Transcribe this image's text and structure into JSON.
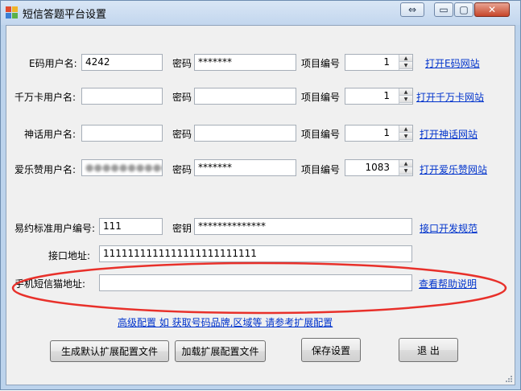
{
  "window": {
    "title": "短信答题平台设置",
    "buttons": {
      "restore": "⇔",
      "minimize": "▭",
      "maximize": "▢",
      "close": "✕"
    }
  },
  "rows": [
    {
      "user_label": "E码用户名:",
      "user_value": "4242",
      "pwd_label": "密码",
      "pwd_value": "*******",
      "proj_label": "项目编号",
      "proj_value": "1",
      "link": "打开E码网站"
    },
    {
      "user_label": "千万卡用户名:",
      "user_value": "",
      "pwd_label": "密码",
      "pwd_value": "",
      "proj_label": "项目编号",
      "proj_value": "1",
      "link": "打开千万卡网站"
    },
    {
      "user_label": "神话用户名:",
      "user_value": "",
      "pwd_label": "密码",
      "pwd_value": "",
      "proj_label": "项目编号",
      "proj_value": "1",
      "link": "打开神话网站"
    },
    {
      "user_label": "爱乐赞用户名:",
      "user_value": "",
      "pwd_label": "密码",
      "pwd_value": "*******",
      "proj_label": "项目编号",
      "proj_value": "1083",
      "link": "打开爱乐赞网站"
    }
  ],
  "yiyue": {
    "user_label": "易约标准用户编号:",
    "user_value": "111",
    "key_label": "密钥",
    "key_value": "**************",
    "link": "接口开发规范"
  },
  "api": {
    "label": "接口地址:",
    "value": "1111111111111111111111111"
  },
  "sms_cat": {
    "label": "手机短信猫地址:",
    "value": "",
    "link": "查看帮助说明"
  },
  "advanced_link": "高级配置 如 获取号码品牌,区域等 请参考扩展配置",
  "bottom_buttons": {
    "generate": "生成默认扩展配置文件",
    "load": "加载扩展配置文件",
    "save": "保存设置",
    "exit": "退 出"
  },
  "colors": {
    "link": "#0033cc",
    "annotation": "#e8302a"
  }
}
